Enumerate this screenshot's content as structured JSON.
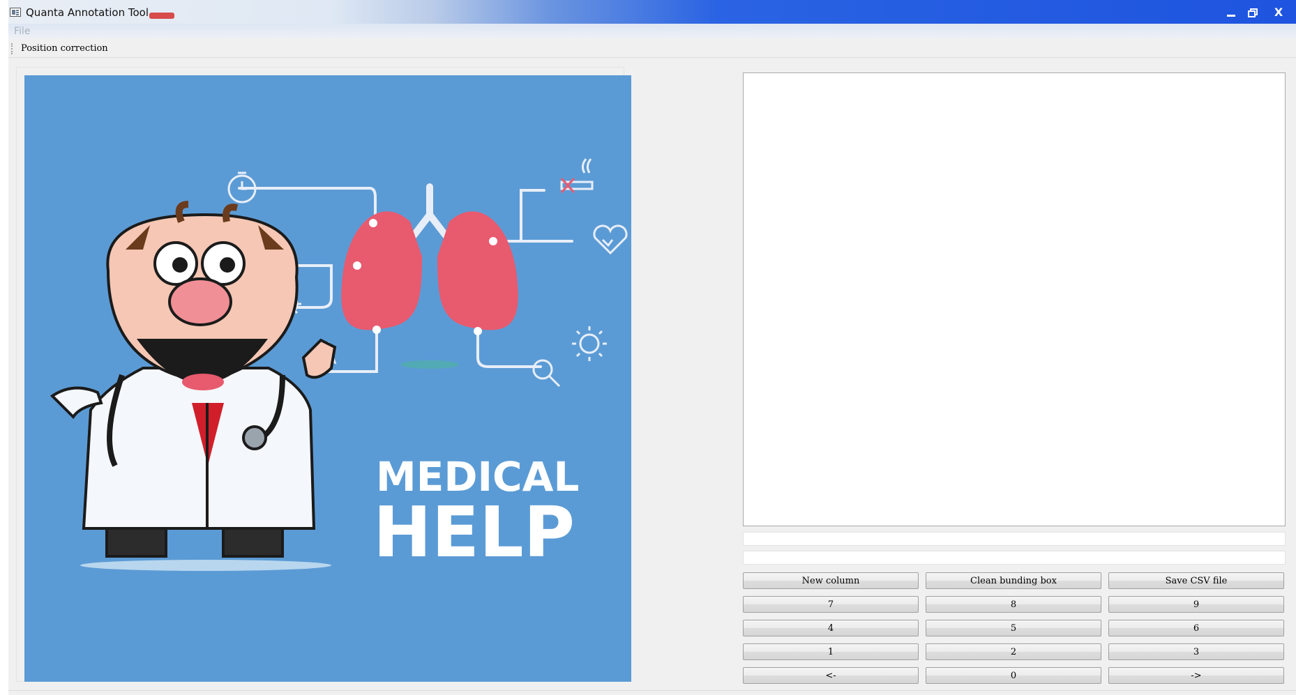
{
  "window": {
    "title": "Quanta Annotation Tool",
    "controls": [
      "minimize",
      "restore",
      "close"
    ],
    "close_glyph": "X"
  },
  "menu": {
    "items": [
      "File"
    ]
  },
  "toolbar": {
    "position_correction": "Position correction"
  },
  "image": {
    "headline_1": "MEDICAL",
    "headline_2": "HELP",
    "background_color": "#5b9bd5",
    "lung_color": "#e85a6e"
  },
  "right_panel": {
    "field_1_value": "",
    "field_2_value": "",
    "buttons": {
      "new_column": "New column",
      "clean_box": "Clean bunding box",
      "save_csv": "Save CSV file",
      "n7": "7",
      "n8": "8",
      "n9": "9",
      "n4": "4",
      "n5": "5",
      "n6": "6",
      "n1": "1",
      "n2": "2",
      "n3": "3",
      "prev": "<-",
      "n0": "0",
      "next": "->"
    }
  }
}
